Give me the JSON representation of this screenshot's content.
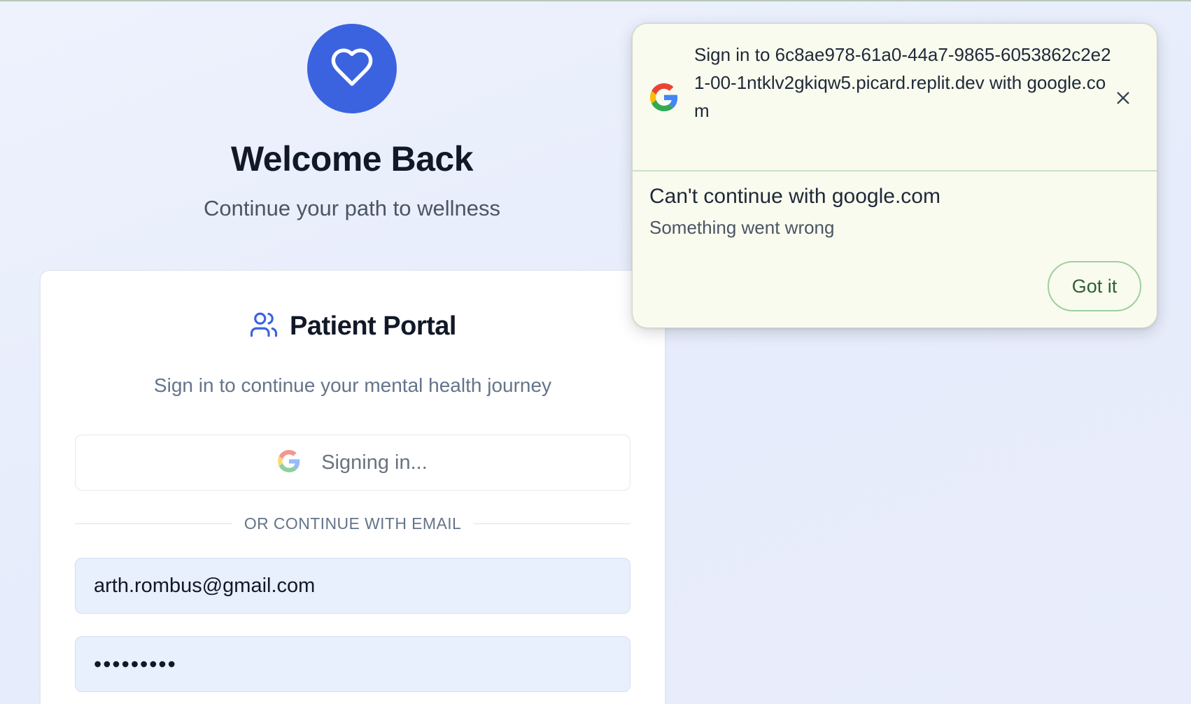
{
  "hero": {
    "icon": "heart-icon",
    "title": "Welcome Back",
    "subtitle": "Continue your path to wellness"
  },
  "card": {
    "icon": "users-icon",
    "title": "Patient Portal",
    "description": "Sign in to continue your mental health journey",
    "google_button": {
      "icon": "google-icon",
      "label": "Signing in..."
    },
    "divider_text": "OR CONTINUE WITH EMAIL",
    "email_value": "arth.rombus@gmail.com",
    "password_mask": "•••••••••"
  },
  "popup": {
    "icon": "google-icon",
    "signin_text": "Sign in to 6c8ae978-61a0-44a7-9865-6053862c2e21-00-1ntklv2gkiqw5.picard.replit.dev with google.com",
    "close_icon": "close-icon",
    "error_title": "Can't continue with google.com",
    "error_subtitle": "Something went wrong",
    "button_label": "Got it"
  },
  "colors": {
    "brand_blue": "#3b63df",
    "popup_bg": "#f9fbef",
    "popup_button_border": "#9fcf9f",
    "field_bg": "#e8effd"
  }
}
